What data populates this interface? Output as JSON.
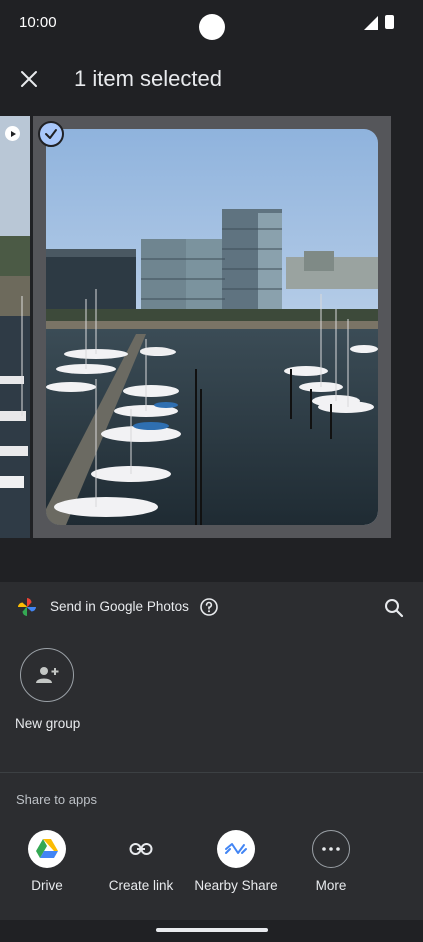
{
  "status_bar": {
    "time": "10:00"
  },
  "header": {
    "title": "1 item selected"
  },
  "sheet": {
    "send_in_label": "Send in Google Photos",
    "new_group_label": "New group",
    "share_to_apps_label": "Share to apps",
    "apps": [
      {
        "label": "Drive",
        "icon": "drive-icon"
      },
      {
        "label": "Create link",
        "icon": "link-icon"
      },
      {
        "label": "Nearby Share",
        "icon": "nearby-share-icon"
      },
      {
        "label": "More",
        "icon": "more-icon"
      }
    ]
  },
  "colors": {
    "accent": "#a8c7fa",
    "background": "#202124",
    "sheet": "#2c2d30"
  }
}
